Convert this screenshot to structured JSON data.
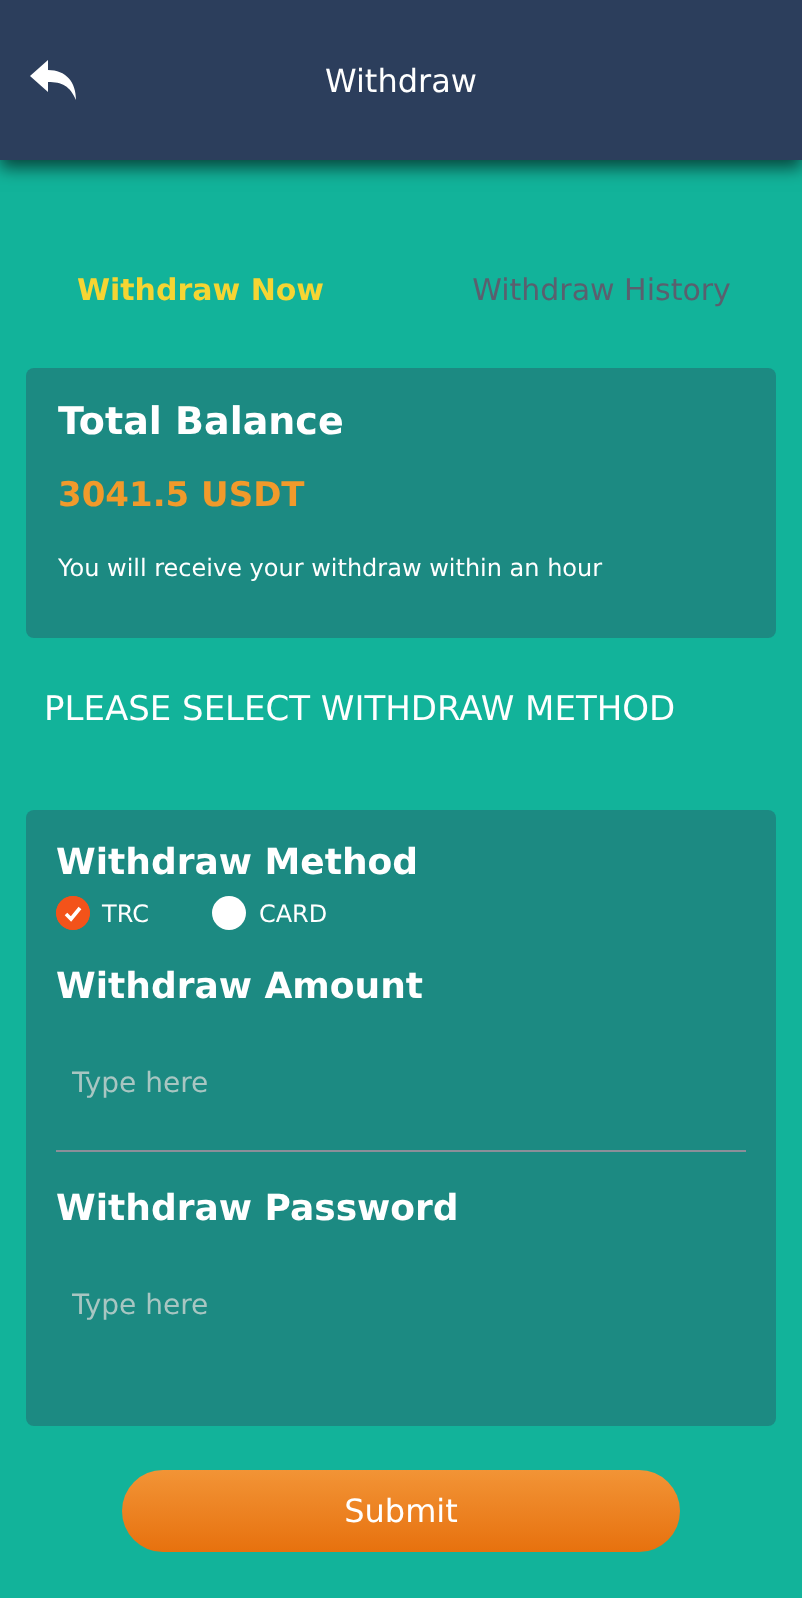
{
  "header": {
    "title": "Withdraw"
  },
  "tabs": [
    {
      "label": "Withdraw Now",
      "selected": true
    },
    {
      "label": "Withdraw History",
      "selected": false
    }
  ],
  "balance": {
    "title": "Total Balance",
    "amount": "3041.5 USDT",
    "note": "You will receive your withdraw within an hour"
  },
  "section_heading": "PLEASE SELECT WITHDRAW METHOD",
  "form": {
    "method_label": "Withdraw Method",
    "methods": [
      {
        "label": "TRC",
        "selected": true
      },
      {
        "label": "CARD",
        "selected": false
      }
    ],
    "fields": [
      {
        "label": "Withdraw Amount",
        "placeholder": "Type here",
        "underlined": true
      },
      {
        "label": "Withdraw Password",
        "placeholder": "Type here",
        "underlined": false
      }
    ]
  },
  "submit": "Submit"
}
